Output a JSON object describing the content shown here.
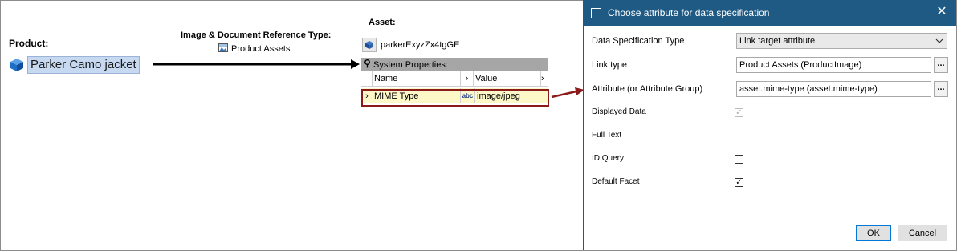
{
  "diagram": {
    "product_label": "Product:",
    "product_name": "Parker Camo jacket",
    "ref_type_label": "Image & Document Reference Type:",
    "ref_type_value": "Product Assets",
    "asset_label": "Asset:",
    "asset_id": "parkerExyzZx4tgGE",
    "grid": {
      "header": "System Properties:",
      "columns": [
        "Name",
        "Value"
      ],
      "row": {
        "name": "MIME Type",
        "type_icon": "abc",
        "value": "image/jpeg"
      }
    }
  },
  "dialog": {
    "title": "Choose attribute for data specification",
    "fields": [
      {
        "label": "Data Specification Type",
        "value": "Link target attribute"
      },
      {
        "label": "Link type",
        "value": "Product Assets (ProductImage)",
        "button": "..."
      },
      {
        "label": "Attribute (or Attribute Group)",
        "value": "asset.mime-type (asset.mime-type)",
        "button": "..."
      }
    ],
    "checkboxes": [
      {
        "label": "Displayed Data",
        "checked": true,
        "disabled": true
      },
      {
        "label": "Full Text",
        "checked": false
      },
      {
        "label": "ID Query",
        "checked": false
      },
      {
        "label": "Default Facet",
        "checked": true
      }
    ],
    "ok_label": "OK",
    "cancel_label": "Cancel"
  },
  "colors": {
    "title_bar": "#1f5a85",
    "highlight_outline": "#8b1a1a",
    "row_fill": "#fdf8c8",
    "selection": "#c6d9f1"
  }
}
